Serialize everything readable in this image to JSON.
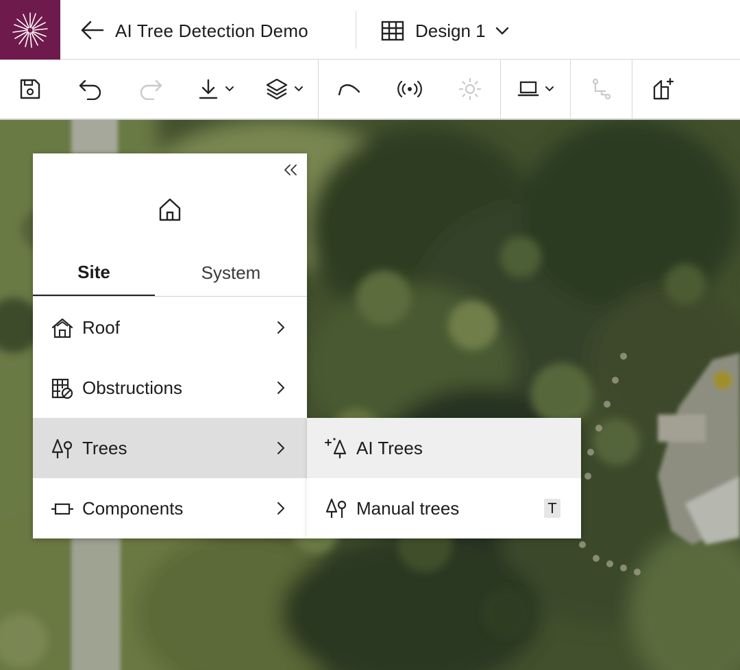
{
  "header": {
    "project_title": "AI Tree Detection Demo",
    "design_name": "Design 1",
    "brand_color": "#6f1a4c"
  },
  "toolbar": {
    "items": [
      {
        "icon": "save-icon"
      },
      {
        "icon": "undo-icon"
      },
      {
        "icon": "redo-icon",
        "disabled": true
      },
      {
        "icon": "download-icon",
        "dropdown": true
      },
      {
        "icon": "layers-icon",
        "dropdown": true
      },
      {
        "icon": "arc-tool-icon"
      },
      {
        "icon": "broadcast-icon"
      },
      {
        "icon": "sun-icon",
        "disabled": true
      },
      {
        "icon": "laptop-icon",
        "dropdown": true
      },
      {
        "icon": "route-icon",
        "disabled": true
      },
      {
        "icon": "add-to-roof-icon"
      }
    ]
  },
  "panel": {
    "tabs": [
      {
        "label": "Site",
        "active": true
      },
      {
        "label": "System",
        "active": false
      }
    ],
    "menu": [
      {
        "label": "Roof",
        "icon": "roof-icon"
      },
      {
        "label": "Obstructions",
        "icon": "obstruction-icon"
      },
      {
        "label": "Trees",
        "icon": "trees-icon",
        "active": true
      },
      {
        "label": "Components",
        "icon": "component-icon"
      }
    ]
  },
  "submenu": {
    "items": [
      {
        "label": "AI Trees",
        "icon": "ai-trees-icon",
        "hover": true
      },
      {
        "label": "Manual trees",
        "icon": "manual-trees-icon",
        "shortcut": "T"
      }
    ]
  }
}
